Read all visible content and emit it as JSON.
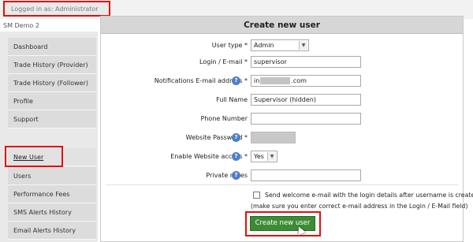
{
  "header": {
    "logged_in": "Logged in as: Administrator",
    "brand": "SM Demo 2"
  },
  "sidebar": {
    "items": [
      {
        "label": "Dashboard"
      },
      {
        "label": "Trade History (Provider)"
      },
      {
        "label": "Trade History (Follower)"
      },
      {
        "label": "Profile"
      },
      {
        "label": "Support"
      },
      {
        "label": "New User"
      },
      {
        "label": "Users"
      },
      {
        "label": "Performance Fees"
      },
      {
        "label": "SMS Alerts History"
      },
      {
        "label": "Email Alerts History"
      }
    ],
    "active": "New User"
  },
  "form": {
    "title": "Create new user",
    "user_type": {
      "label": "User type *",
      "value": "Admin",
      "options": [
        "Admin"
      ]
    },
    "login": {
      "label": "Login / E-mail *",
      "value": "supervisor"
    },
    "notifications_email": {
      "label": "Notifications E-mail address *",
      "value_start": "in",
      "value_end": ".com"
    },
    "full_name": {
      "label": "Full Name",
      "value": "Supervisor (hidden)"
    },
    "phone": {
      "label": "Phone Number",
      "value": ""
    },
    "website_password": {
      "label": "Website Password *"
    },
    "website_access": {
      "label": "Enable Website access *",
      "value": "Yes",
      "options": [
        "Yes"
      ]
    },
    "private_notes": {
      "label": "Private notes",
      "value": ""
    },
    "send_welcome": {
      "label": "Send welcome e-mail with the login details after username is created",
      "checked": false
    },
    "send_welcome_note": "(make sure you enter correct e-mail address in the Login / E-Mail field)",
    "submit_label": "Create new user",
    "help_icon": "?"
  },
  "colors": {
    "accent_highlight": "#e01010",
    "submit_green": "#3c8c35",
    "help_blue": "#4f7fc4"
  },
  "icons": {
    "help": "help-circle-icon",
    "dropdown": "chevron-down-icon",
    "cursor": "mouse-pointer-icon"
  }
}
